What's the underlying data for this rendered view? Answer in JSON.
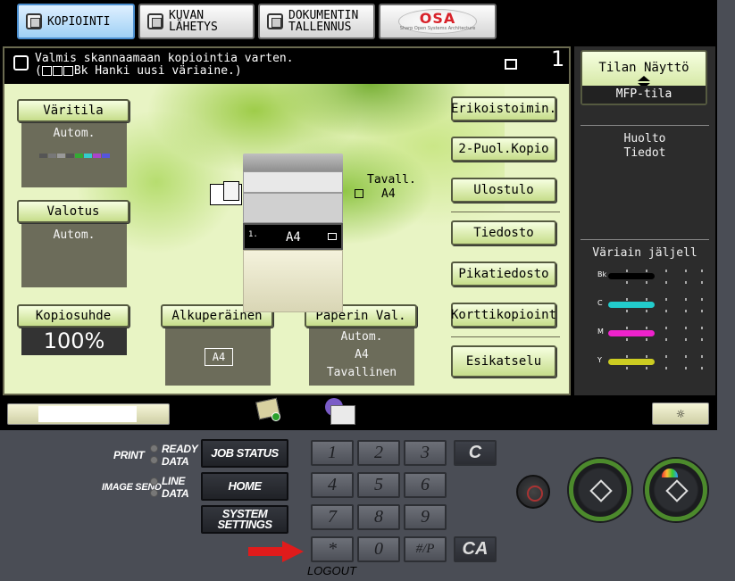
{
  "tabs": {
    "copy": {
      "line1": "KOPIOINTI"
    },
    "send": {
      "line1": "KUVAN",
      "line2": "LÄHETYS"
    },
    "store": {
      "line1": "DOKUMENTIN",
      "line2": "TALLENNUS"
    },
    "osa": {
      "logo_text": "OSA",
      "logo_sub": "Sharp Open Systems Architecture"
    }
  },
  "message": {
    "line1": "Valmis skannaamaan kopiointia varten.",
    "line2_prefix": "(",
    "line2_box_label": "Bk",
    "line2_suffix": " Hanki uusi väriaine.)"
  },
  "copies": "1",
  "left_settings": {
    "color_mode": {
      "label": "Väritila",
      "value": "Autom."
    },
    "exposure": {
      "label": "Valotus",
      "value": "Autom."
    },
    "ratio": {
      "label": "Kopiosuhde",
      "value": "100%"
    },
    "original": {
      "label": "Alkuperäinen",
      "value": "A4"
    },
    "paper": {
      "label": "Paperin Val.",
      "value1": "Autom.",
      "value2": "A4",
      "value3": "Tavallinen"
    }
  },
  "swatch_colors": [
    "#555555",
    "#777777",
    "#999999",
    "#555555",
    "#33aa33",
    "#33cccc",
    "#aa44cc",
    "#5555dd"
  ],
  "machine": {
    "tray_number": "1.",
    "tray_size": "A4"
  },
  "output_tray": {
    "type": "Tavall.",
    "size": "A4"
  },
  "side_buttons": {
    "special": "Erikoistoimin.",
    "duplex": "2-Puol.Kopio",
    "output": "Ulostulo",
    "file": "Tiedosto",
    "quick_file": "Pikatiedosto",
    "card": "Korttikopioint",
    "preview": "Esikatselu"
  },
  "right": {
    "status_title": "Tilan Näyttö",
    "mode": "MFP-tila",
    "maintenance_line1": "Huolto",
    "maintenance_line2": "Tiedot",
    "toner_title": "Väriain jäljell",
    "toners": [
      {
        "label": "Bk",
        "color": "#000000"
      },
      {
        "label": "C",
        "color": "#22cccc"
      },
      {
        "label": "M",
        "color": "#ee22cc"
      },
      {
        "label": "Y",
        "color": "#cccc22"
      }
    ]
  },
  "brightness_icon": "☼",
  "hardware": {
    "print_label": "PRINT",
    "ready_label": "READY",
    "data_label": "DATA",
    "image_send_label": "IMAGE SEND",
    "line_label": "LINE",
    "data_label2": "DATA",
    "job_status": "JOB STATUS",
    "home": "HOME",
    "system_settings_line1": "SYSTEM",
    "system_settings_line2": "SETTINGS",
    "keys": [
      "1",
      "2",
      "3",
      "4",
      "5",
      "6",
      "7",
      "8",
      "9",
      "*",
      "0",
      "#/P"
    ],
    "clear": "C",
    "clear_all": "CA",
    "logout": "LOGOUT"
  }
}
